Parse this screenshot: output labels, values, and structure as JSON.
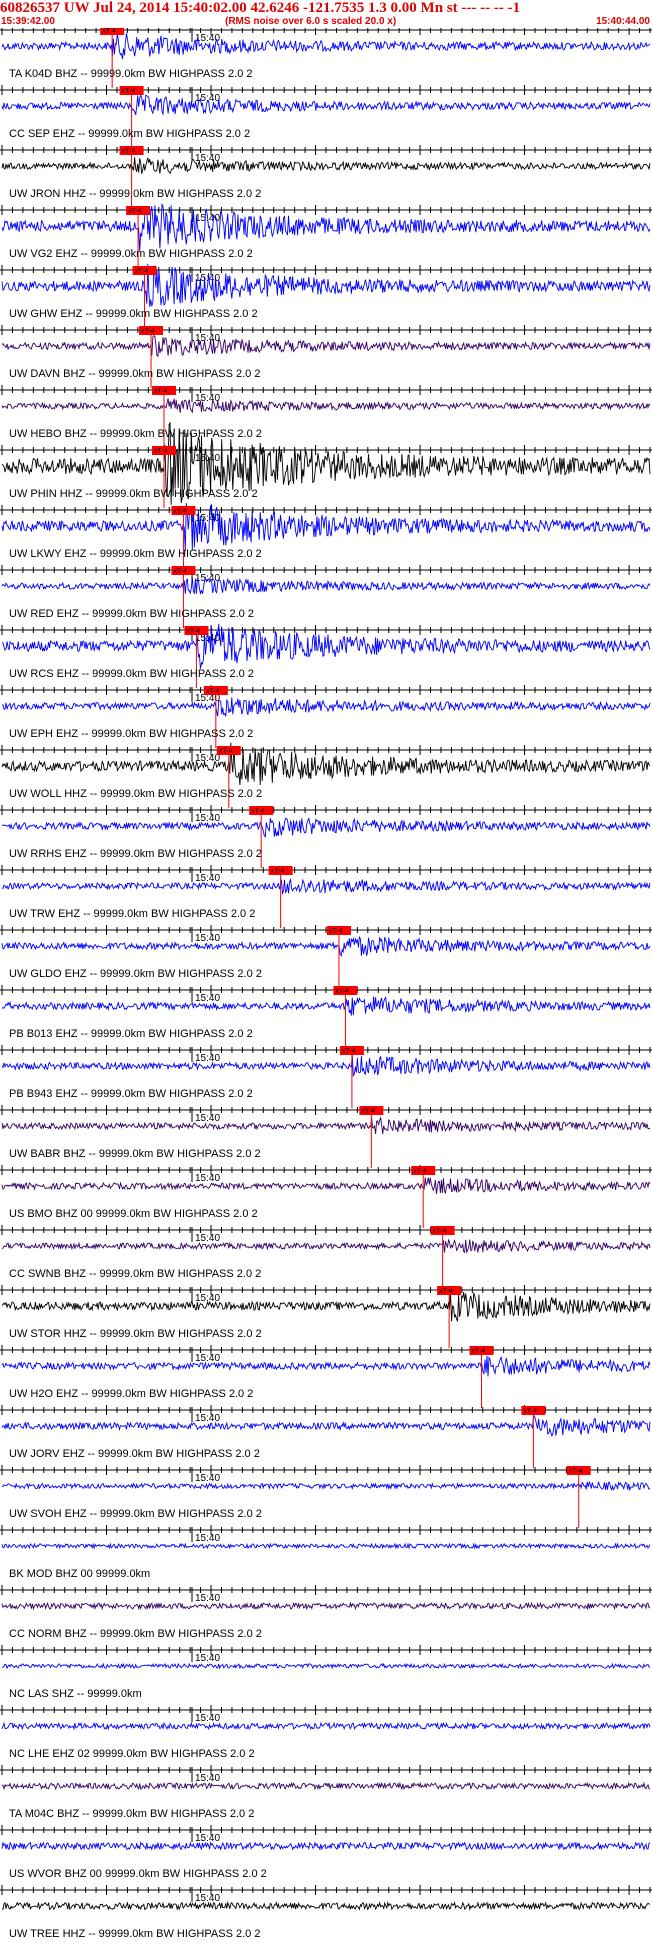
{
  "header": {
    "title": "60826537 UW Jul 24, 2014 15:40:02.00   42.6246 -121.7535  1.3 0.00 Mn st --- -- --  -1",
    "start_time": "15:39:42.00",
    "noise_note": "(RMS noise over 6.0 s scaled 20.0 x)",
    "end_time": "15:40:44.00"
  },
  "colors": {
    "header": "#e00000",
    "pick": "#ff0000",
    "blue": "#0000ff",
    "black": "#000000",
    "purple": "#330066",
    "axis": "#000000"
  },
  "minute_label": "15:40",
  "pick_label": "xT-4",
  "traces": [
    {
      "label": "TA K04D BHZ -- 99999.0km BW  HIGHPASS  2.0  2",
      "color": "blue",
      "amp": 0.25,
      "pick": 0.17
    },
    {
      "label": "CC SEP EHZ -- 99999.0km BW  HIGHPASS  2.0  2",
      "color": "blue",
      "amp": 0.2,
      "pick": 0.2
    },
    {
      "label": "UW JRON HHZ -- 99999.0km BW  HIGHPASS  2.0  2",
      "color": "black",
      "amp": 0.15,
      "pick": 0.2
    },
    {
      "label": "UW VG2 EHZ -- 99999.0km BW  HIGHPASS  2.0  2",
      "color": "blue",
      "amp": 0.5,
      "pick": 0.21
    },
    {
      "label": "UW GHW EHZ -- 99999.0km BW  HIGHPASS  2.0  2",
      "color": "blue",
      "amp": 0.45,
      "pick": 0.22
    },
    {
      "label": "UW DAVN BHZ -- 99999.0km BW  HIGHPASS  2.0  2",
      "color": "purple",
      "amp": 0.2,
      "pick": 0.23
    },
    {
      "label": "UW HEBO BHZ -- 99999.0km BW  HIGHPASS  2.0  2",
      "color": "purple",
      "amp": 0.12,
      "pick": 0.25
    },
    {
      "label": "UW PHIN HHZ -- 99999.0km BW  HIGHPASS  2.0  2",
      "color": "black",
      "amp": 0.9,
      "pick": 0.25
    },
    {
      "label": "UW LKWY EHZ -- 99999.0km BW  HIGHPASS  2.0  2",
      "color": "blue",
      "amp": 0.5,
      "pick": 0.28
    },
    {
      "label": "UW RED EHZ -- 99999.0km BW  HIGHPASS  2.0  2",
      "color": "blue",
      "amp": 0.15,
      "pick": 0.28
    },
    {
      "label": "UW RCS EHZ -- 99999.0km BW  HIGHPASS  2.0  2",
      "color": "blue",
      "amp": 0.5,
      "pick": 0.3
    },
    {
      "label": "UW EPH EHZ -- 99999.0km BW  HIGHPASS  2.0  2",
      "color": "blue",
      "amp": 0.2,
      "pick": 0.33
    },
    {
      "label": "UW WOLL HHZ -- 99999.0km BW  HIGHPASS  2.0  2",
      "color": "black",
      "amp": 0.45,
      "pick": 0.35
    },
    {
      "label": "UW RRHS EHZ -- 99999.0km BW  HIGHPASS  2.0  2",
      "color": "blue",
      "amp": 0.2,
      "pick": 0.4
    },
    {
      "label": "UW TRW EHZ -- 99999.0km BW  HIGHPASS  2.0  2",
      "color": "blue",
      "amp": 0.15,
      "pick": 0.43
    },
    {
      "label": "UW GLDO EHZ -- 99999.0km BW  HIGHPASS  2.0  2",
      "color": "blue",
      "amp": 0.2,
      "pick": 0.52
    },
    {
      "label": "PB B013 EHZ -- 99999.0km BW  HIGHPASS  2.0  2",
      "color": "blue",
      "amp": 0.2,
      "pick": 0.53
    },
    {
      "label": "PB B943 EHZ -- 99999.0km BW  HIGHPASS  2.0  2",
      "color": "blue",
      "amp": 0.2,
      "pick": 0.54
    },
    {
      "label": "UW BABR BHZ -- 99999.0km BW  HIGHPASS  2.0  2",
      "color": "purple",
      "amp": 0.15,
      "pick": 0.57
    },
    {
      "label": "US BMO BHZ 00 99999.0km BW  HIGHPASS  2.0  2",
      "color": "purple",
      "amp": 0.15,
      "pick": 0.65
    },
    {
      "label": "CC SWNB BHZ -- 99999.0km BW  HIGHPASS  2.0  2",
      "color": "purple",
      "amp": 0.12,
      "pick": 0.68
    },
    {
      "label": "UW STOR HHZ -- 99999.0km BW  HIGHPASS  2.0  2",
      "color": "black",
      "amp": 0.3,
      "pick": 0.69
    },
    {
      "label": "UW H2O EHZ -- 99999.0km BW  HIGHPASS  2.0  2",
      "color": "blue",
      "amp": 0.2,
      "pick": 0.74
    },
    {
      "label": "UW JORV EHZ -- 99999.0km BW  HIGHPASS  2.0  2",
      "color": "blue",
      "amp": 0.2,
      "pick": 0.82
    },
    {
      "label": "UW SVOH EHZ -- 99999.0km BW  HIGHPASS  2.0  2",
      "color": "blue",
      "amp": 0.05,
      "pick": 0.89
    },
    {
      "label": "BK MOD BHZ 00 99999.0km",
      "color": "blue",
      "amp": 0.0,
      "pick": null
    },
    {
      "label": "CC NORM BHZ -- 99999.0km BW  HIGHPASS  2.0  2",
      "color": "purple",
      "amp": 0.12,
      "pick": null
    },
    {
      "label": "NC LAS SHZ -- 99999.0km",
      "color": "blue",
      "amp": 0.0,
      "pick": null
    },
    {
      "label": "NC LHE EHZ 02 99999.0km BW  HIGHPASS  2.0  2",
      "color": "blue",
      "amp": 0.12,
      "pick": null
    },
    {
      "label": "TA M04C BHZ -- 99999.0km BW  HIGHPASS  2.0  2",
      "color": "purple",
      "amp": 0.12,
      "pick": null
    },
    {
      "label": "US WVOR BHZ 00 99999.0km BW  HIGHPASS  2.0  2",
      "color": "blue",
      "amp": 0.2,
      "pick": null
    },
    {
      "label": "UW TREE HHZ -- 99999.0km BW  HIGHPASS  2.0  2",
      "color": "black",
      "amp": 0.2,
      "pick": null
    }
  ]
}
